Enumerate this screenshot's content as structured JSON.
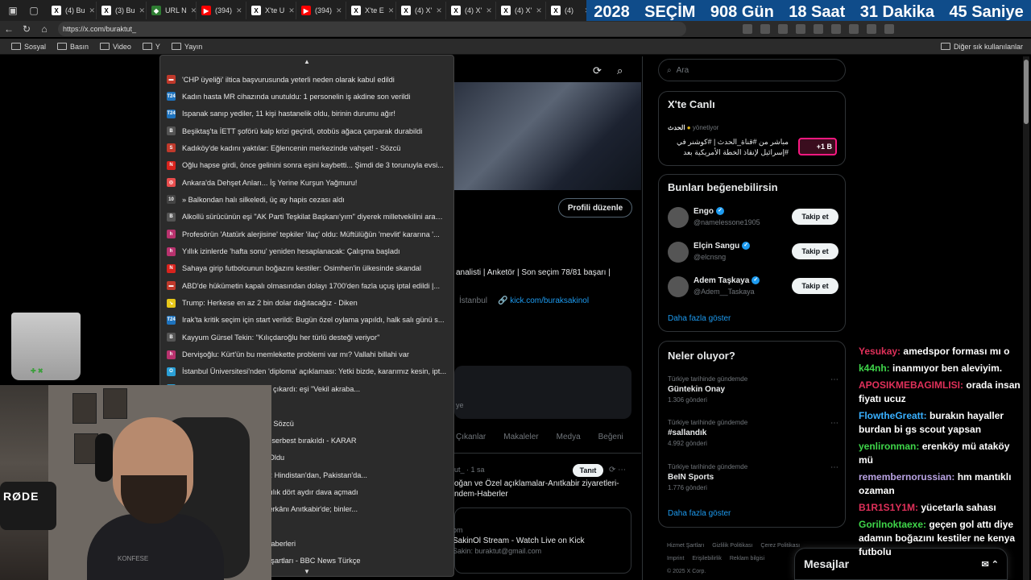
{
  "tabs": [
    {
      "label": "(4) Bu",
      "icon": "x"
    },
    {
      "label": "(3) Bu",
      "icon": "x"
    },
    {
      "label": "URL N",
      "icon": "url"
    },
    {
      "label": "(394)",
      "icon": "yt"
    },
    {
      "label": "X'te U",
      "icon": "x"
    },
    {
      "label": "(394)",
      "icon": "yt"
    },
    {
      "label": "X'te E",
      "icon": "x"
    },
    {
      "label": "(4) X'",
      "icon": "x"
    },
    {
      "label": "(4) X'",
      "icon": "x"
    },
    {
      "label": "(4) X'",
      "icon": "x"
    },
    {
      "label": "(4)",
      "icon": "x"
    }
  ],
  "countdown": {
    "year": "2028",
    "election": "SEÇİM",
    "days": "908 Gün",
    "hours": "18 Saat",
    "minutes": "31 Dakika",
    "seconds": "45 Saniye"
  },
  "address": {
    "url": "https://x.com/buraktut_"
  },
  "bookmarks": {
    "items": [
      "Sosyal",
      "Basın",
      "Video",
      "Y",
      "Yayın"
    ],
    "other": "Diğer sık kullanılanlar"
  },
  "news": [
    {
      "text": "'CHP üyeliği' iltica başvurusunda yeterli neden olarak kabul edildi",
      "color": "#c0392b",
      "glyph": "▬"
    },
    {
      "text": "Kadın hasta MR cihazında unutuldu: 1 personelin iş akdine son verildi",
      "color": "#1e73be",
      "glyph": "T24"
    },
    {
      "text": "Ispanak sanıp yediler, 11 kişi hastanelik oldu, birinin durumu ağır!",
      "color": "#1e73be",
      "glyph": "T24"
    },
    {
      "text": "Beşiktaş'ta İETT şoförü kalp krizi geçirdi, otobüs ağaca çarparak durabildi",
      "color": "#555555",
      "glyph": "B"
    },
    {
      "text": "Kadıköy'de kadını yaktılar: Eğlencenin merkezinde vahşet! - Sözcü",
      "color": "#c0392b",
      "glyph": "S"
    },
    {
      "text": "Oğlu hapse girdi, önce gelinini sonra eşini kaybetti... Şimdi de 3 torunuyla evsi...",
      "color": "#d9231d",
      "glyph": "N"
    },
    {
      "text": "Ankara'da Dehşet Anları... İş Yerine Kurşun Yağmuru!",
      "color": "#e84d4d",
      "glyph": "◎"
    },
    {
      "text": "» Balkondan halı silkeledi, üç ay hapis cezası aldı",
      "color": "#444444",
      "glyph": "10"
    },
    {
      "text": "Alkollü sürücünün eşi \"AK Parti Teşkilat Başkanı'yım\" diyerek milletvekilini aradı...",
      "color": "#555555",
      "glyph": "B"
    },
    {
      "text": "Profesörün 'Atatürk alerjisine' tepkiler 'ilaç' oldu: Müftülüğün 'mevlit' kararına '...",
      "color": "#b8326e",
      "glyph": "h"
    },
    {
      "text": "Yıllık izinlerde 'hafta sonu' yeniden hesaplanacak: Çalışma başladı",
      "color": "#b8326e",
      "glyph": "h"
    },
    {
      "text": "Sahaya girip futbolcunun boğazını kestiler: Osimhen'in ülkesinde skandal",
      "color": "#d9231d",
      "glyph": "N"
    },
    {
      "text": "ABD'de hükümetin kapalı olmasından dolayı 1700'den fazla uçuş iptal edildi |...",
      "color": "#c0392b",
      "glyph": "▬"
    },
    {
      "text": "Trump: Herkese en az 2 bin dolar dağıtacağız - Diken",
      "color": "#e6c619",
      "glyph": "↘"
    },
    {
      "text": "Irak'ta kritik seçim için start verildi: Bugün özel oylama yapıldı, halk salı günü s...",
      "color": "#1e73be",
      "glyph": "T24"
    },
    {
      "text": "Kayyum Gürsel Tekin: \"Kılıçdaroğlu her türlü desteği veriyor\"",
      "color": "#555555",
      "glyph": "B"
    },
    {
      "text": "Dervişoğlu: Kürt'ün bu memlekette problemi var mı? Vallahi billahi var",
      "color": "#b8326e",
      "glyph": "h"
    },
    {
      "text": "İstanbul Üniversitesi'nden 'diploma' açıklaması: Yetki bizde, kararımız kesin, ipt...",
      "color": "#2a9fd6",
      "glyph": "O"
    },
    {
      "text": "...\" diyen adam trafikte olay çıkardı: eşi \"Vekil akraba...",
      "color": "#2a9fd6",
      "glyph": "•"
    },
    {
      "text": "...şta",
      "color": "#555555",
      "glyph": "•"
    },
    {
      "text": "...vekillerden sürpriz karar - Sözcü",
      "color": "#c0392b",
      "glyph": "S"
    },
    {
      "text": "...nunda Eski Genel Müdür serbest bırakıldı - KARAR",
      "color": "#555555",
      "glyph": "K"
    },
    {
      "text": "...aniği! 84 Kişi Hastanelik Oldu",
      "color": "#e84d4d",
      "glyph": "◎"
    },
    {
      "text": "...gazeteye CHP'yi eleştirdi: Hindistan'dan, Pakistan'da...",
      "color": "#555555",
      "glyph": "•"
    },
    {
      "text": "...nan Aktaş skandalı: Savcılık dört aydır dava açmadı",
      "color": "#555555",
      "glyph": "•"
    },
    {
      "text": "... Atatürk'ü anıyor: Devlet erkânı Anıtkabir'de; binler...",
      "color": "#555555",
      "glyph": "•"
    },
    {
      "text": "",
      "color": "#2b2b2b",
      "glyph": ""
    },
    {
      "text": "...nıtkabir'de | Son dakika haberleri",
      "color": "#555555",
      "glyph": "•"
    },
    {
      "text": "...Merak edilenler, başvuru şartları - BBC News Türkçe",
      "color": "#555555",
      "glyph": "•"
    }
  ],
  "profile": {
    "edit_label": "Profili düzenle",
    "bio": "analisti | Anketör | Son seçim 78/81 başarı |",
    "location": "İstanbul",
    "link": "kick.com/buraksakinol",
    "grey_card_text": "ye",
    "tabs": [
      "Çıkanlar",
      "Makaleler",
      "Medya",
      "Beğeni"
    ],
    "post_meta": "ut_ · 1 sa",
    "follow_small": "Tanıt",
    "post_text": "oğan ve Özel açıklamalar-Anıtkabir ziyaretleri-ndem-Haberler",
    "card_line1": "om",
    "card_line2": "SakinOl Stream - Watch Live on Kick",
    "card_line3": "Sakin: buraktut@gmail.com"
  },
  "sidebar": {
    "search_placeholder": "Ara",
    "live": {
      "title": "X'te Canlı",
      "host": "الحدث",
      "host_suffix": "yönetiyor",
      "text": "مباشر من #قناة_الحدث | #كوشنر في #إسرائيل لإنقاذ الخطة الأمريكية بعد",
      "badge": "+1 B"
    },
    "suggest_title": "Bunları beğenebilirsin",
    "suggest": [
      {
        "name": "Engo",
        "handle": "@namelessone1905",
        "btn": "Takip et"
      },
      {
        "name": "Elçin Sangu",
        "handle": "@elcnsng",
        "btn": "Takip et"
      },
      {
        "name": "Adem Taşkaya",
        "handle": "@Adem__Taskaya",
        "btn": "Takip et"
      }
    ],
    "show_more": "Daha fazla göster",
    "trends_title": "Neler oluyor?",
    "trends": [
      {
        "context": "Türkiye tarihinde gündemde",
        "topic": "Güntekin Onay",
        "count": "1.306 gönderi"
      },
      {
        "context": "Türkiye tarihinde gündemde",
        "topic": "#sallandık",
        "count": "4.992 gönderi"
      },
      {
        "context": "Türkiye tarihinde gündemde",
        "topic": "BeIN Sports",
        "count": "1.776 gönderi"
      }
    ],
    "trends_more": "Daha fazla göster",
    "footer": [
      "Hizmet Şartları",
      "Gizlilik Politikası",
      "Çerez Politikası",
      "Imprint",
      "Erişilebilirlik",
      "Reklam bilgisi",
      "© 2025 X Corp."
    ]
  },
  "messages": {
    "label": "Mesajlar"
  },
  "webcam": {
    "brand": "RØDE",
    "watermark": "KONFESE"
  },
  "chat": [
    {
      "user": "Yesukay:",
      "color": "#e0305a",
      "text": "amedspor forması mı o"
    },
    {
      "user": "k44nh:",
      "color": "#3fd64a",
      "text": "inanmıyor ben aleviyim."
    },
    {
      "user": "APOSIKMEBAGIMLISI:",
      "color": "#e0305a",
      "text": "orada insan fiyatı ucuz"
    },
    {
      "user": "FlowtheGreatt:",
      "color": "#39b0ff",
      "text": "burakın hayaller burdan bi gs scout yapsan"
    },
    {
      "user": "yenlironman:",
      "color": "#3fd64a",
      "text": "erenköy mü ataköy mü"
    },
    {
      "user": "remembernorussian:",
      "color": "#b9a3e3",
      "text": "hm mantıklı ozaman"
    },
    {
      "user": "B1R1S1Y1M:",
      "color": "#e0305a",
      "text": "yücetarla sahası"
    },
    {
      "user": "Gorilnoktaexe:",
      "color": "#3fd64a",
      "text": "geçen gol attı diye adamın boğazını kestiler ne kenya futbolu"
    }
  ],
  "colors": {
    "accent": "#1d9bf0",
    "countdown_bg": "#0f4c8a"
  }
}
